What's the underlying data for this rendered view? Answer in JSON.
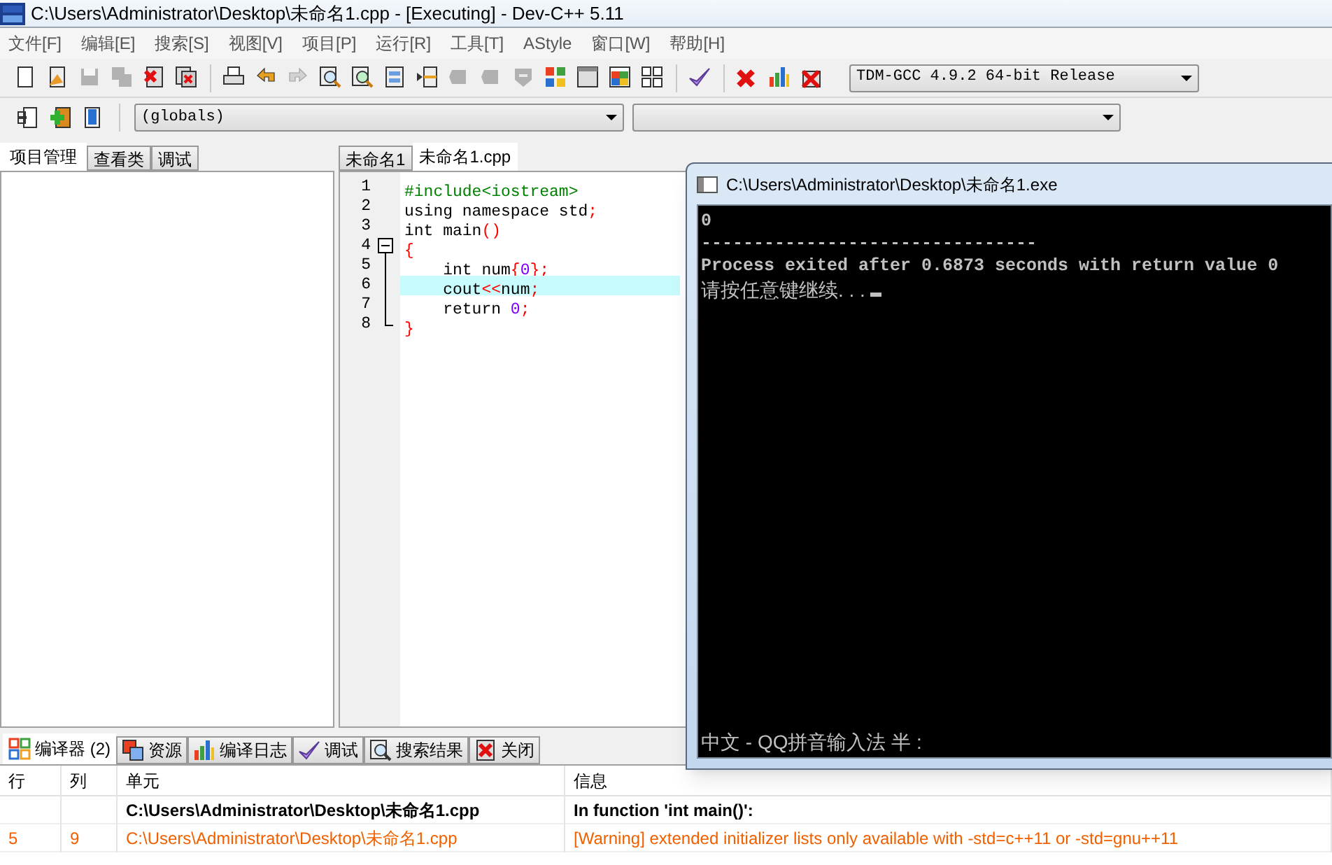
{
  "window": {
    "title": "C:\\Users\\Administrator\\Desktop\\未命名1.cpp - [Executing] - Dev-C++ 5.11"
  },
  "menu": [
    "文件[F]",
    "编辑[E]",
    "搜索[S]",
    "视图[V]",
    "项目[P]",
    "运行[R]",
    "工具[T]",
    "AStyle",
    "窗口[W]",
    "帮助[H]"
  ],
  "toolbar_1": [
    {
      "disabled": false
    },
    {
      "disabled": false
    },
    {
      "disabled": true
    },
    {
      "disabled": true
    },
    {
      "disabled": false
    },
    {
      "disabled": false
    },
    {
      "disabled": false
    },
    {
      "disabled": false
    },
    {
      "disabled": true
    },
    {
      "disabled": false
    },
    {
      "disabled": false
    },
    {
      "disabled": false
    },
    {
      "disabled": false
    },
    {
      "disabled": true
    },
    {
      "disabled": true
    },
    {
      "disabled": true
    },
    {
      "disabled": false
    },
    {
      "disabled": false
    },
    {
      "disabled": false
    },
    {
      "disabled": false
    },
    {
      "disabled": false
    },
    {
      "disabled": false
    },
    {
      "disabled": false
    },
    {
      "disabled": false
    }
  ],
  "compiler_select": {
    "value": "TDM-GCC 4.9.2 64-bit Release"
  },
  "toolbar_2": {
    "scope_select": {
      "value": "(globals)"
    }
  },
  "left_tabs": [
    {
      "label": "项目管理",
      "selected": true
    },
    {
      "label": "查看类",
      "selected": false
    },
    {
      "label": "调试",
      "selected": false
    }
  ],
  "editor_tabs": [
    {
      "label": "未命名1",
      "selected": false
    },
    {
      "label": "未命名1.cpp",
      "selected": true
    }
  ],
  "code": [
    {
      "number": "1",
      "highlighted": false,
      "tokens": [
        {
          "text": "#include<iostream>",
          "kind": "preprocessor"
        }
      ]
    },
    {
      "number": "2",
      "highlighted": false,
      "tokens": [
        {
          "text": "using namespace std",
          "kind": "plain"
        },
        {
          "text": ";",
          "kind": "symbol"
        }
      ]
    },
    {
      "number": "3",
      "highlighted": false,
      "tokens": [
        {
          "text": "int main",
          "kind": "plain"
        },
        {
          "text": "()",
          "kind": "symbol"
        }
      ]
    },
    {
      "number": "4",
      "highlighted": false,
      "kind": "fold-start",
      "tokens": [
        {
          "text": "{",
          "kind": "symbol"
        }
      ]
    },
    {
      "number": "5",
      "highlighted": false,
      "kind": "fold-body",
      "tokens": [
        {
          "text": "    int num",
          "kind": "plain"
        },
        {
          "text": "{",
          "kind": "symbol"
        },
        {
          "text": "0",
          "kind": "number"
        },
        {
          "text": "};",
          "kind": "symbol"
        }
      ]
    },
    {
      "number": "6",
      "highlighted": true,
      "kind": "fold-body",
      "tokens": [
        {
          "text": "    cout",
          "kind": "plain"
        },
        {
          "text": "<<",
          "kind": "symbol"
        },
        {
          "text": "num",
          "kind": "plain"
        },
        {
          "text": ";",
          "kind": "symbol"
        }
      ]
    },
    {
      "number": "7",
      "highlighted": false,
      "kind": "fold-body",
      "tokens": [
        {
          "text": "    return ",
          "kind": "plain"
        },
        {
          "text": "0",
          "kind": "number"
        },
        {
          "text": ";",
          "kind": "symbol"
        }
      ]
    },
    {
      "number": "8",
      "highlighted": false,
      "kind": "fold-end",
      "tokens": [
        {
          "text": "}",
          "kind": "symbol"
        }
      ]
    }
  ],
  "console": {
    "title": "C:\\Users\\Administrator\\Desktop\\未命名1.exe",
    "lines": [
      "0",
      "--------------------------------",
      "Process exited after 0.6873 seconds with return value 0"
    ],
    "prompt": "请按任意键继续. . . ",
    "cursor": true,
    "ime_status": "中文 - QQ拼音输入法 半 :"
  },
  "bottom_tabs": [
    {
      "label": "编译器 (2)",
      "selected": true
    },
    {
      "label": "资源",
      "selected": false
    },
    {
      "label": "编译日志",
      "selected": false
    },
    {
      "label": "调试",
      "selected": false
    },
    {
      "label": "搜索结果",
      "selected": false
    },
    {
      "label": "关闭",
      "selected": false
    }
  ],
  "messages": {
    "columns": [
      "行",
      "列",
      "单元",
      "信息"
    ],
    "rows": [
      {
        "kind": "context",
        "cells": [
          "",
          "",
          "C:\\Users\\Administrator\\Desktop\\未命名1.cpp",
          "In function 'int main()':"
        ]
      },
      {
        "kind": "warning",
        "cells": [
          "5",
          "9",
          "C:\\Users\\Administrator\\Desktop\\未命名1.cpp",
          "[Warning] extended initializer lists only available with -std=c++11 or -std=gnu++11"
        ]
      }
    ]
  }
}
